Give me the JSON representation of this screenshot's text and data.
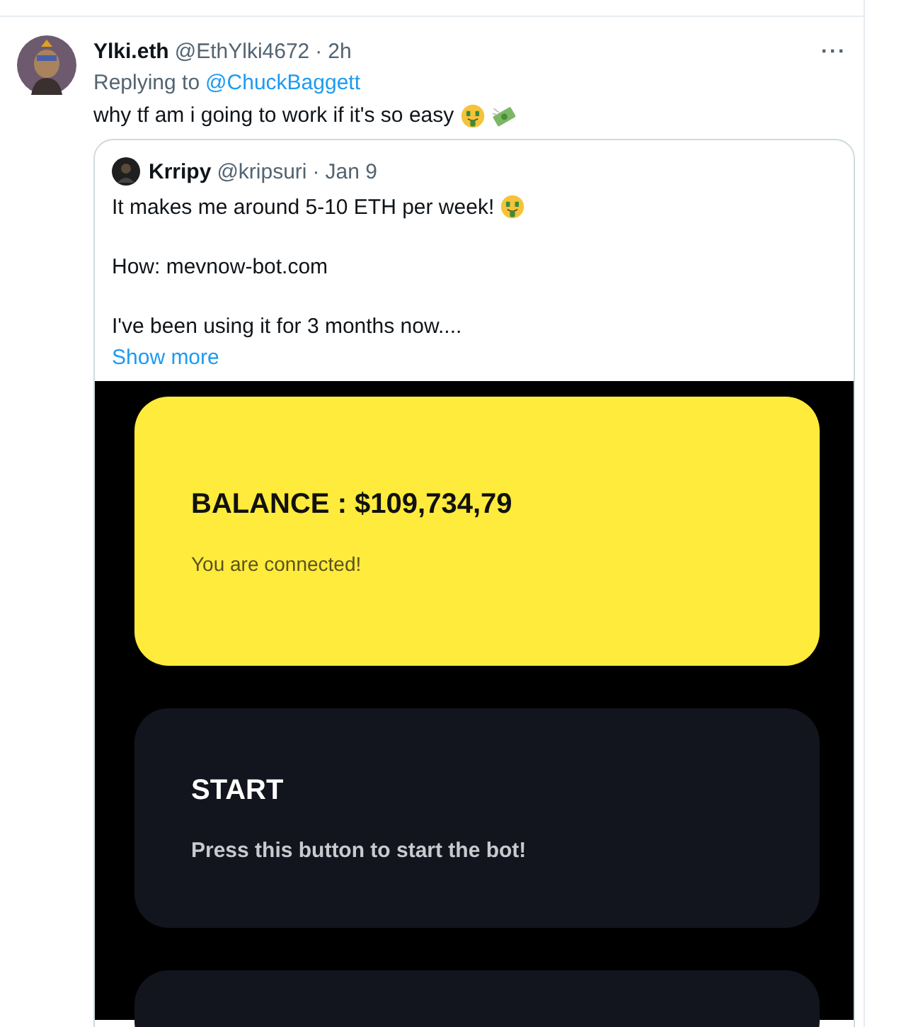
{
  "tweet": {
    "name": "Ylki.eth",
    "handle": "@EthYlki4672",
    "dot": "·",
    "time": "2h",
    "more": "···",
    "replying_label": "Replying to",
    "replying_to": "@ChuckBaggett",
    "text": "why tf am i going to work if it's so easy"
  },
  "quoted_tweet": {
    "name": "Krripy",
    "handle": "@kripsuri",
    "dot": "·",
    "date": "Jan 9",
    "lines": [
      "It makes me around 5-10 ETH per week!",
      "How: mevnow-bot.com",
      "I've been using it for 3 months now...."
    ],
    "show_more": "Show more",
    "screenshot": {
      "cards": [
        {
          "kind": "balance",
          "title": "BALANCE : $109,734,79",
          "subtitle": "You are connected!"
        },
        {
          "kind": "action",
          "title": "START",
          "subtitle": "Press this button to start the bot!"
        },
        {
          "kind": "empty"
        }
      ]
    }
  }
}
